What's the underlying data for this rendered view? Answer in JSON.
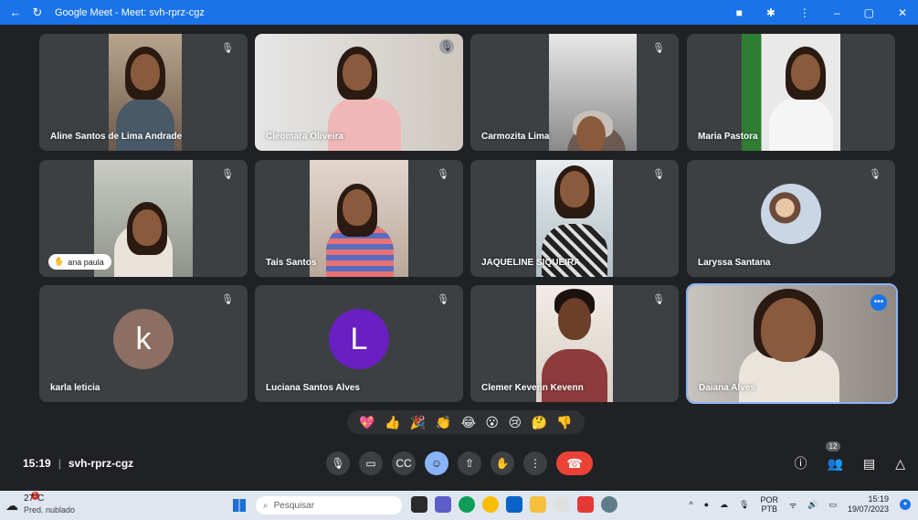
{
  "window": {
    "title": "Google Meet - Meet: svh-rprz-cgz",
    "icons": [
      "back-arrow-icon",
      "reload-icon",
      "camera-icon",
      "extension-icon",
      "menu-dots-icon",
      "minimize-icon",
      "maximize-icon",
      "close-icon"
    ]
  },
  "tiles": [
    {
      "name": "Aline Santos de Lima Andrade",
      "type": "video",
      "muted": true
    },
    {
      "name": "Cleomara Oliveira",
      "type": "video",
      "muted": true
    },
    {
      "name": "Carmozita Lima",
      "type": "video",
      "muted": true
    },
    {
      "name": "Maria Pastora",
      "type": "video",
      "muted": false
    },
    {
      "name": "ana paula",
      "type": "video",
      "muted": true,
      "pill": true
    },
    {
      "name": "Taís Santos",
      "type": "video",
      "muted": true
    },
    {
      "name": "JAQUELINE SIQUEIRA",
      "type": "video",
      "muted": true
    },
    {
      "name": "Laryssa Santana",
      "type": "photo-avatar",
      "muted": true
    },
    {
      "name": "karla leticia",
      "type": "letter-avatar",
      "letter": "k",
      "avatar_color": "#8d6e63",
      "muted": true
    },
    {
      "name": "Luciana Santos Alves",
      "type": "letter-avatar",
      "letter": "L",
      "avatar_color": "#6a1fc2",
      "muted": true
    },
    {
      "name": "Clemer Kevenn Kevenn",
      "type": "video",
      "muted": true
    },
    {
      "name": "Daiana Alves",
      "type": "video",
      "muted": false,
      "active": true
    }
  ],
  "reactions": [
    "💖",
    "👍",
    "🎉",
    "👏",
    "😂",
    "😮",
    "😢",
    "🤔",
    "👎"
  ],
  "meeting": {
    "time": "15:19",
    "code": "svh-rprz-cgz",
    "participant_count": "12"
  },
  "controls": [
    "mic-icon",
    "camera-icon",
    "captions-icon",
    "emoji-icon",
    "present-icon",
    "raise-hand-icon",
    "more-options-icon",
    "end-call-icon"
  ],
  "taskbar": {
    "weather_temp": "27°C",
    "weather_desc": "Pred. nublado",
    "alert_count": "1",
    "search_placeholder": "Pesquisar",
    "lang_top": "POR",
    "lang_bottom": "PTB",
    "clock_time": "15:19",
    "clock_date": "19/07/2023"
  },
  "colors": {
    "accent": "#1a73e8",
    "end_call": "#ea4335",
    "tile_bg": "#3c4043",
    "page_bg": "#202124"
  }
}
